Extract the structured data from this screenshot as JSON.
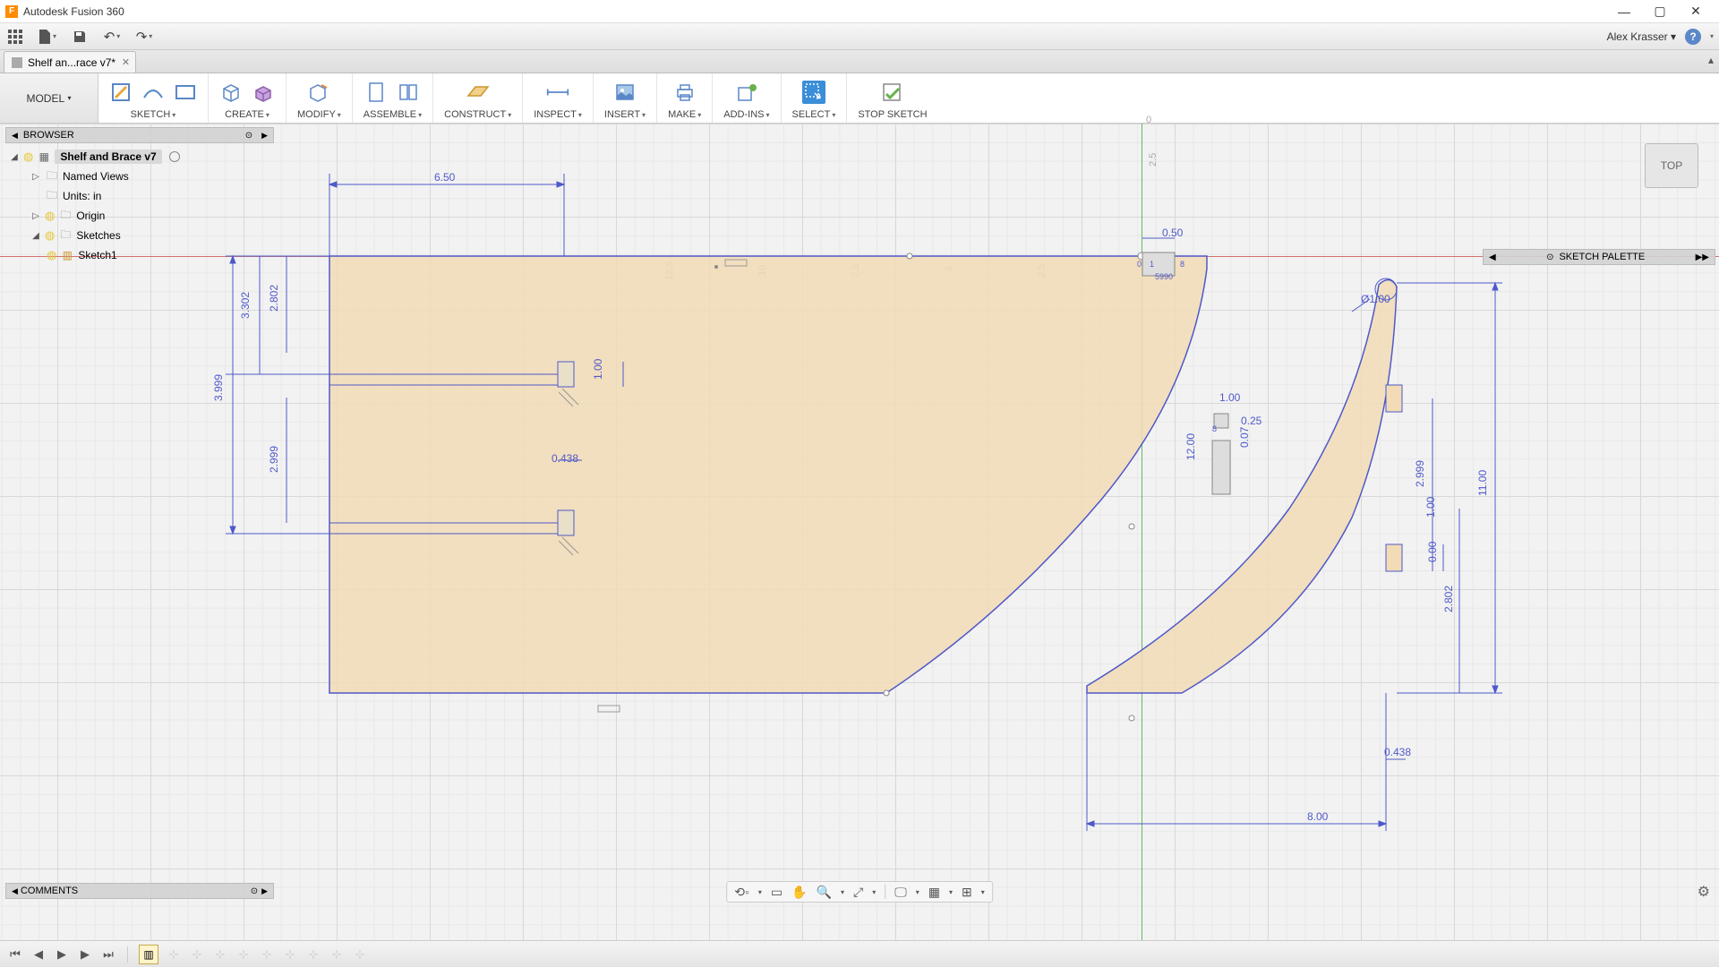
{
  "app": {
    "title": "Autodesk Fusion 360",
    "logo_letter": "F"
  },
  "user": {
    "name": "Alex Krasser"
  },
  "tab": {
    "label": "Shelf an...race v7*"
  },
  "ribbon": {
    "model": "MODEL",
    "groups": [
      {
        "label": "SKETCH"
      },
      {
        "label": "CREATE"
      },
      {
        "label": "MODIFY"
      },
      {
        "label": "ASSEMBLE"
      },
      {
        "label": "CONSTRUCT"
      },
      {
        "label": "INSPECT"
      },
      {
        "label": "INSERT"
      },
      {
        "label": "MAKE"
      },
      {
        "label": "ADD-INS"
      },
      {
        "label": "SELECT"
      },
      {
        "label": "STOP SKETCH"
      }
    ]
  },
  "browser": {
    "title": "BROWSER",
    "root": "Shelf and Brace v7",
    "items": {
      "named_views": "Named Views",
      "units": "Units: in",
      "origin": "Origin",
      "sketches": "Sketches",
      "sketch1": "Sketch1"
    }
  },
  "palette": {
    "title": "SKETCH PALETTE"
  },
  "comments": {
    "title": "COMMENTS"
  },
  "viewcube": {
    "face": "TOP"
  },
  "ruler": {
    "x": [
      "12.5",
      "10",
      "7.5",
      "5",
      "2.5"
    ],
    "y_top": "0",
    "y_below": "2.5"
  },
  "dimensions": {
    "top_650": "6.50",
    "left_3302": "3.302",
    "left_2802": "2.802",
    "left_3999": "3.999",
    "left_2999": "2.999",
    "slot_100": "1.00",
    "slot_0438": "0.438",
    "right_050": "0.50",
    "right_100": "1.00",
    "right_025": "0.25",
    "right_007": "0.07",
    "right_1200": "12.00",
    "dia_100": "Ø1.00",
    "r_1100": "11.00",
    "r_2999": "2.999",
    "r_00_top": "1.00",
    "r_00_mid": "0.00",
    "r_2802": "2.802",
    "r_0438": "0.438",
    "bottom_800": "8.00",
    "tiny_0": "0",
    "tiny_1": "1",
    "tiny_59": "59",
    "tiny_90": "90",
    "tiny_8": "8",
    "tiny_8b": "8"
  }
}
